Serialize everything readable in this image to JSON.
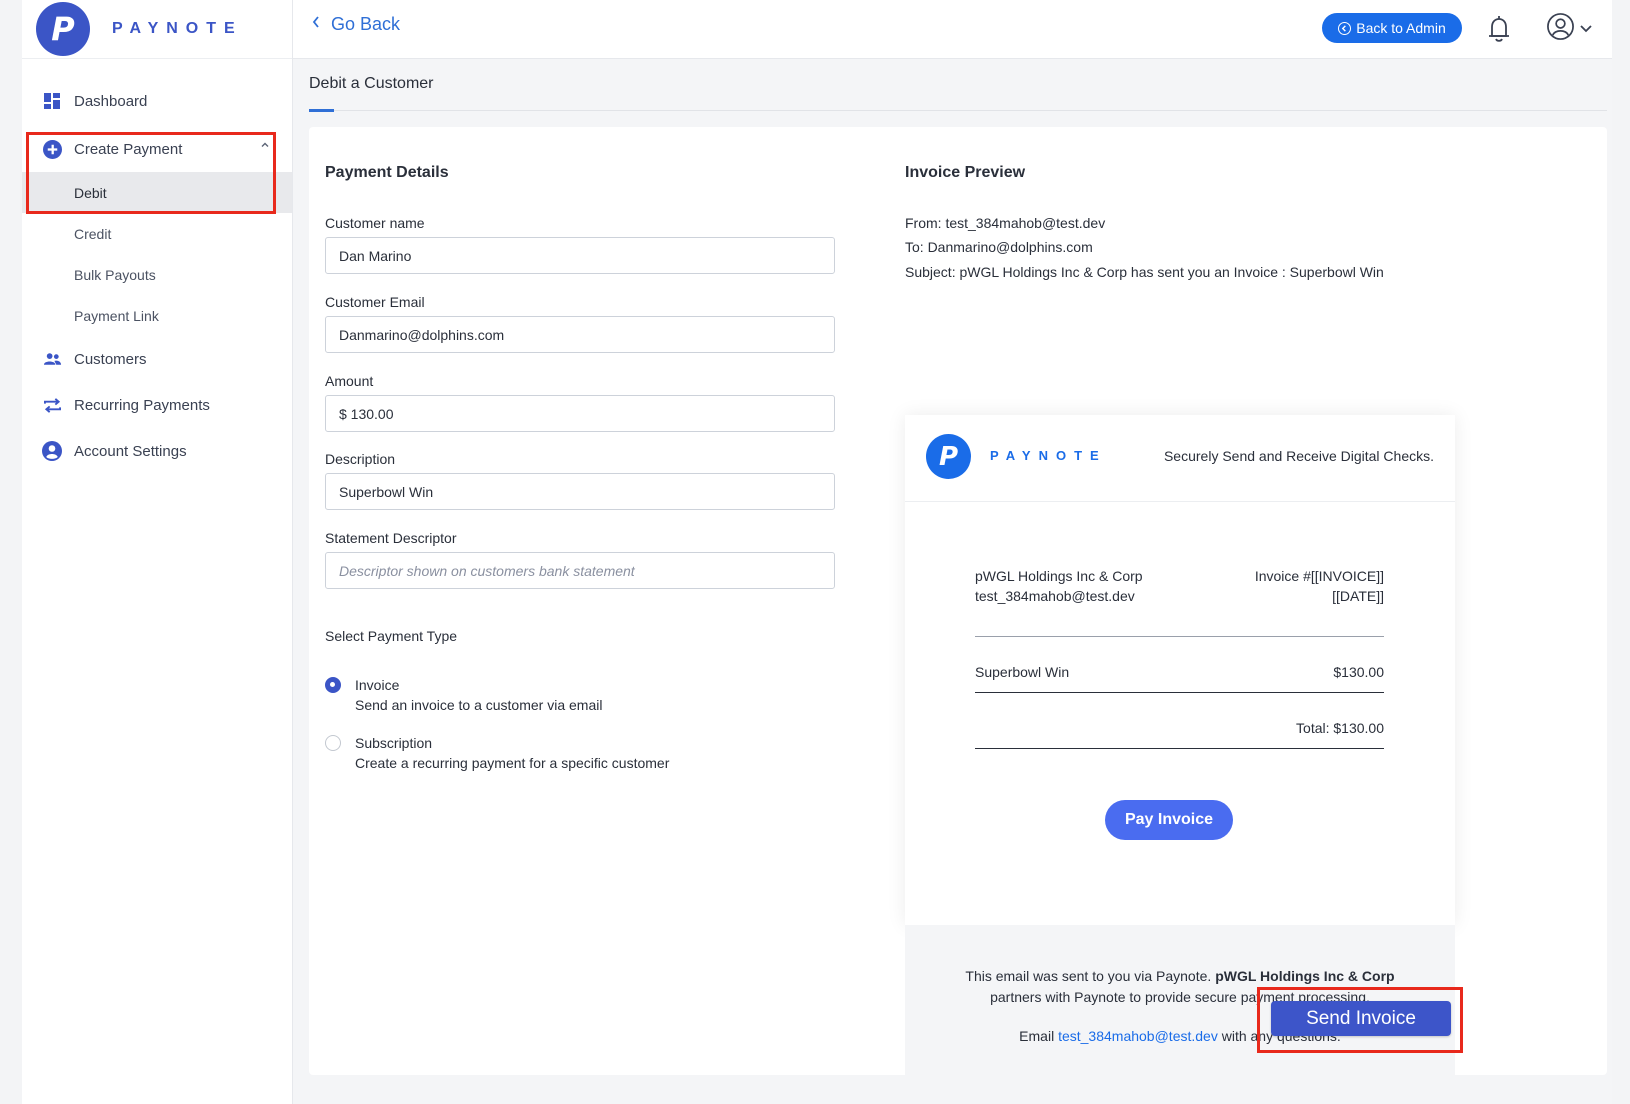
{
  "app": {
    "logo_letter": "P",
    "brand_name": "PAYNOTE"
  },
  "sidebar": {
    "items": [
      {
        "label": "Dashboard",
        "icon": "dashboard-grid-icon"
      },
      {
        "label": "Create Payment",
        "icon": "plus-circle-icon",
        "expanded": true,
        "children": [
          {
            "label": "Debit",
            "active": true
          },
          {
            "label": "Credit"
          },
          {
            "label": "Bulk Payouts"
          },
          {
            "label": "Payment Link"
          }
        ]
      },
      {
        "label": "Customers",
        "icon": "users-icon"
      },
      {
        "label": "Recurring Payments",
        "icon": "repeat-arrows-icon"
      },
      {
        "label": "Account Settings",
        "icon": "user-circle-icon"
      }
    ]
  },
  "topbar": {
    "back_label": "Go Back",
    "admin_button": "Back to Admin",
    "notification_icon": "bell-icon",
    "user_icon": "user-circle-icon"
  },
  "page": {
    "title": "Debit a Customer"
  },
  "form": {
    "section_title": "Payment Details",
    "customer_name_label": "Customer name",
    "customer_name_value": "Dan Marino",
    "customer_email_label": "Customer Email",
    "customer_email_value": "Danmarino@dolphins.com",
    "amount_label": "Amount",
    "amount_value": "$ 130.00",
    "description_label": "Description",
    "description_value": "Superbowl Win",
    "statement_label": "Statement Descriptor",
    "statement_placeholder": "Descriptor shown on customers bank statement",
    "payment_type_label": "Select Payment Type",
    "payment_types": [
      {
        "title": "Invoice",
        "desc": "Send an invoice to a customer via email",
        "selected": true
      },
      {
        "title": "Subscription",
        "desc": "Create a recurring payment for a specific customer",
        "selected": false
      }
    ]
  },
  "preview": {
    "section_title": "Invoice Preview",
    "from": "From: test_384mahob@test.dev",
    "to": "To: Danmarino@dolphins.com",
    "subject": "Subject: pWGL Holdings Inc & Corp has sent you an Invoice : Superbowl Win",
    "email": {
      "logo_letter": "P",
      "brand": "PAYNOTE",
      "tagline": "Securely Send and Receive Digital Checks.",
      "company": "pWGL Holdings Inc & Corp",
      "company_email": "test_384mahob@test.dev",
      "invoice_number": "Invoice #[[INVOICE]]",
      "date": "[[DATE]]",
      "line_item": "Superbowl Win",
      "line_amount": "$130.00",
      "total": "Total: $130.00",
      "pay_button": "Pay Invoice",
      "footer_prefix": "This email was sent to you via Paynote.",
      "footer_company": "pWGL Holdings Inc & Corp",
      "footer_suffix": "partners with Paynote to provide secure payment processing.",
      "footer_email_prefix": "Email",
      "footer_email": "test_384mahob@test.dev",
      "footer_email_suffix": "with any questions."
    }
  },
  "actions": {
    "send_button": "Send Invoice"
  },
  "colors": {
    "brand_blue": "#3b55c6",
    "link_blue": "#1a6ce8",
    "highlight_red": "#e8291c"
  }
}
